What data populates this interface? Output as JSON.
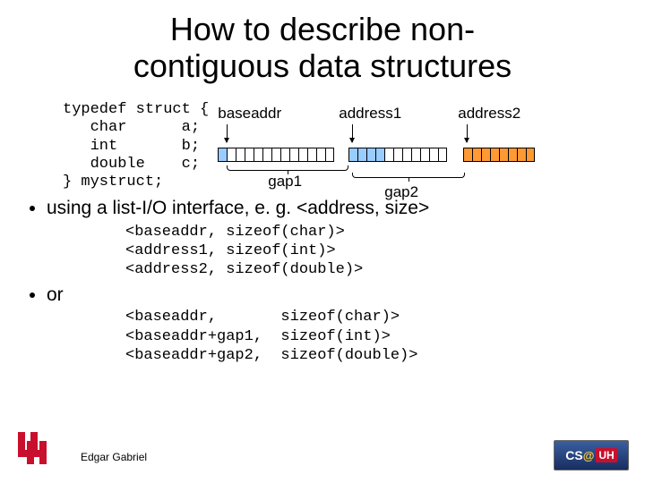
{
  "title_l1": "How to describe non-",
  "title_l2": "contiguous data structures",
  "code": {
    "l1": "typedef struct {",
    "l2": "   char      a;",
    "l3": "   int       b;",
    "l4": "   double    c;",
    "l5": "} mystruct;"
  },
  "diagram": {
    "baseaddr": "baseaddr",
    "address1": "address1",
    "address2": "address2",
    "gap1": "gap1",
    "gap2": "gap2"
  },
  "bullet1": "using a list-I/O interface, e. g. <address, size>",
  "listio": {
    "l1": "<baseaddr, sizeof(char)>",
    "l2": "<address1, sizeof(int)>",
    "l3": "<address2, sizeof(double)>"
  },
  "or_label": "or",
  "listio2": {
    "l1": "<baseaddr,       sizeof(char)>",
    "l2": "<baseaddr+gap1,  sizeof(int)>",
    "l3": "<baseaddr+gap2,  sizeof(double)>"
  },
  "author": "Edgar Gabriel",
  "cs_logo_text": "CS",
  "cs_logo_at": "@",
  "cs_logo_uh": "UH"
}
